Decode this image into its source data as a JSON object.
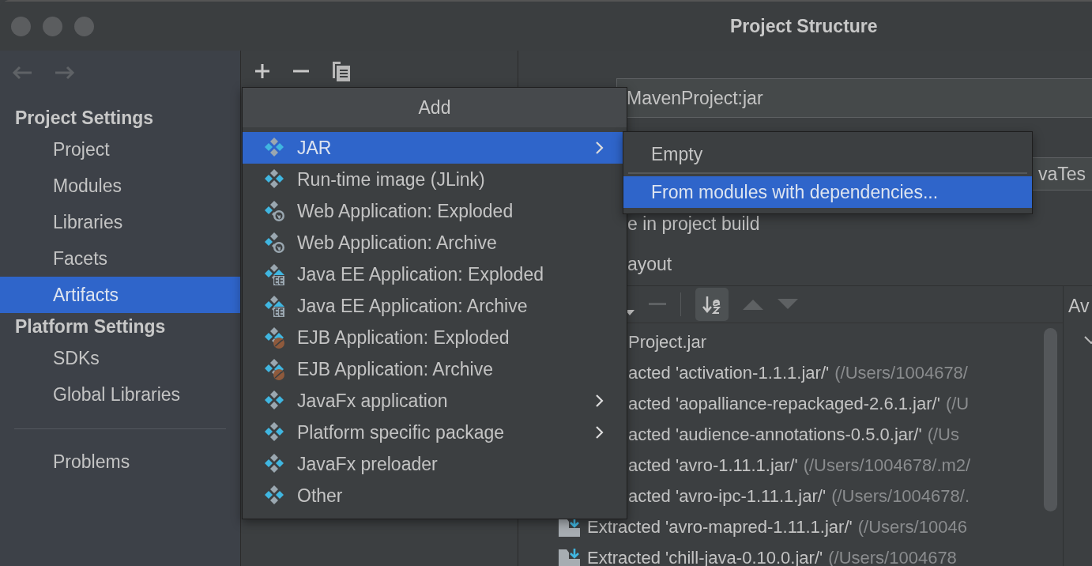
{
  "window": {
    "title": "Project Structure"
  },
  "sidebar": {
    "sections": [
      {
        "heading": "Project Settings",
        "items": [
          {
            "label": "Project",
            "selected": false
          },
          {
            "label": "Modules",
            "selected": false
          },
          {
            "label": "Libraries",
            "selected": false
          },
          {
            "label": "Facets",
            "selected": false
          },
          {
            "label": "Artifacts",
            "selected": true
          }
        ]
      },
      {
        "heading": "Platform Settings",
        "items": [
          {
            "label": "SDKs",
            "selected": false
          },
          {
            "label": "Global Libraries",
            "selected": false
          }
        ]
      }
    ],
    "bottom_items": [
      {
        "label": "Problems",
        "selected": false
      }
    ]
  },
  "add_menu": {
    "title": "Add",
    "items": [
      {
        "label": "JAR",
        "kind": "plain",
        "submenu": true,
        "selected": true
      },
      {
        "label": "Run-time image (JLink)",
        "kind": "plain",
        "submenu": false,
        "selected": false
      },
      {
        "label": "Web Application: Exploded",
        "kind": "web",
        "submenu": false,
        "selected": false
      },
      {
        "label": "Web Application: Archive",
        "kind": "web",
        "submenu": false,
        "selected": false
      },
      {
        "label": "Java EE Application: Exploded",
        "kind": "ee",
        "submenu": false,
        "selected": false
      },
      {
        "label": "Java EE Application: Archive",
        "kind": "ee",
        "submenu": false,
        "selected": false
      },
      {
        "label": "EJB Application: Exploded",
        "kind": "ejb",
        "submenu": false,
        "selected": false
      },
      {
        "label": "EJB Application: Archive",
        "kind": "ejb",
        "submenu": false,
        "selected": false
      },
      {
        "label": "JavaFx application",
        "kind": "plain",
        "submenu": true,
        "selected": false
      },
      {
        "label": "Platform specific package",
        "kind": "plain",
        "submenu": true,
        "selected": false
      },
      {
        "label": "JavaFx preloader",
        "kind": "plain",
        "submenu": false,
        "selected": false
      },
      {
        "label": "Other",
        "kind": "plain",
        "submenu": false,
        "selected": false
      }
    ]
  },
  "submenu": {
    "items": [
      {
        "label": "Empty",
        "selected": false
      },
      {
        "label": "From modules with dependencies...",
        "selected": true
      }
    ]
  },
  "artifact": {
    "name": "MavenProject:jar",
    "field_2": "vaTes",
    "option_text": "e in project build",
    "section_label": "ayout",
    "side_label": "Av",
    "tree": [
      {
        "kind": "clipped",
        "name": "Project.jar"
      },
      {
        "kind": "clipped",
        "name": "acted 'activation-1.1.1.jar/'",
        "path": "(/Users/1004678/"
      },
      {
        "kind": "clipped",
        "name": "acted 'aopalliance-repackaged-2.6.1.jar/'",
        "path": "(/U"
      },
      {
        "kind": "clipped",
        "name": "acted 'audience-annotations-0.5.0.jar/'",
        "path": "(/Us"
      },
      {
        "kind": "clipped",
        "name": "acted 'avro-1.11.1.jar/'",
        "path": "(/Users/1004678/.m2/"
      },
      {
        "kind": "clipped",
        "name": "acted 'avro-ipc-1.11.1.jar/'",
        "path": "(/Users/1004678/."
      },
      {
        "kind": "full",
        "name": "Extracted 'avro-mapred-1.11.1.jar/'",
        "path": "(/Users/10046"
      },
      {
        "kind": "full",
        "name": "Extracted 'chill-java-0.10.0.jar/'",
        "path": "(/Users/1004678"
      }
    ]
  }
}
